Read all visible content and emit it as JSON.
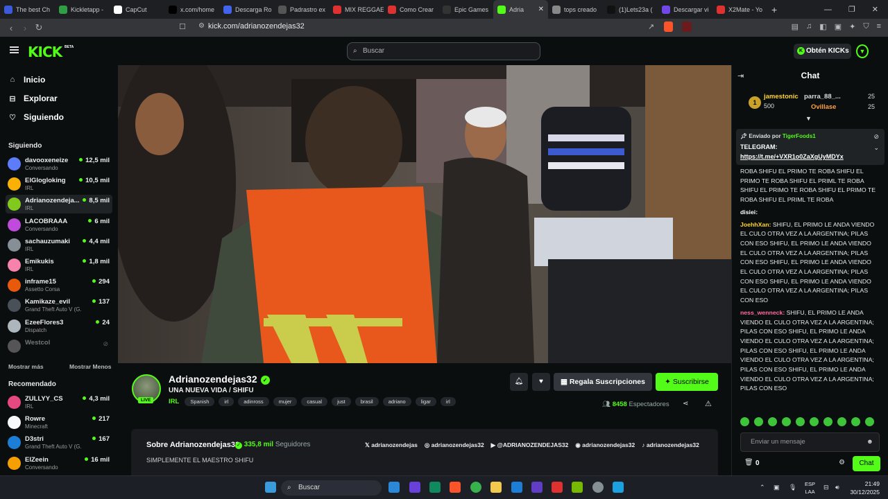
{
  "browser": {
    "tabs": [
      {
        "label": "The best Ch",
        "fav": "globe-icon",
        "color": "#3b5bdb"
      },
      {
        "label": "Kickletapp -",
        "fav": "app-icon",
        "color": "#2f9e44"
      },
      {
        "label": "CapCut",
        "fav": "capcut-icon",
        "color": "#ffffff"
      },
      {
        "label": "x.com/home",
        "fav": "x-icon",
        "color": "#000000"
      },
      {
        "label": "Descarga Ro",
        "fav": "roblox-icon",
        "color": "#4263eb"
      },
      {
        "label": "Padrastro ex",
        "fav": "reddit-icon",
        "color": "#555555"
      },
      {
        "label": "MIX REGGAE",
        "fav": "youtube-icon",
        "color": "#e03131"
      },
      {
        "label": "Como Crear",
        "fav": "youtube-icon",
        "color": "#e03131"
      },
      {
        "label": "Epic Games",
        "fav": "epic-icon",
        "color": "#333333"
      },
      {
        "label": "Adria",
        "fav": "kick-icon",
        "color": "#53fc18",
        "active": true
      },
      {
        "label": "tops creado",
        "fav": "globe-icon",
        "color": "#888888"
      },
      {
        "label": "(1)Lets23a (",
        "fav": "tiktok-icon",
        "color": "#111111"
      },
      {
        "label": "Descargar vi",
        "fav": "twitch-icon",
        "color": "#7048e8"
      },
      {
        "label": "X2Mate - Yo",
        "fav": "x2mate-icon",
        "color": "#e03131"
      }
    ],
    "url": "kick.com/adrianozendejas32"
  },
  "header": {
    "logo": "KICK",
    "beta": "BETA",
    "search_placeholder": "Buscar",
    "get_kicks": "Obtén KICKs"
  },
  "sidebar": {
    "nav": [
      {
        "label": "Inicio",
        "icon": "home-icon"
      },
      {
        "label": "Explorar",
        "icon": "compass-icon"
      },
      {
        "label": "Siguiendo",
        "icon": "heart-icon"
      }
    ],
    "following_title": "Siguiendo",
    "following": [
      {
        "name": "davooxeneize",
        "category": "Conversando",
        "viewers": "12,5 mil",
        "color": "#5c7cfa"
      },
      {
        "name": "ElGlogloking",
        "category": "IRL",
        "viewers": "10,5 mil",
        "color": "#fab005"
      },
      {
        "name": "Adrianozendeja...",
        "category": "IRL",
        "viewers": "8,5 mil",
        "color": "#82c91e",
        "selected": true
      },
      {
        "name": "LACOBRAAA",
        "category": "Conversando",
        "viewers": "6 mil",
        "color": "#be4bdb"
      },
      {
        "name": "sachauzumaki",
        "category": "IRL",
        "viewers": "4,4 mil",
        "color": "#868e96"
      },
      {
        "name": "Emikukis",
        "category": "IRL",
        "viewers": "1,8 mil",
        "color": "#f783ac"
      },
      {
        "name": "inframe15",
        "category": "Assetto Corsa",
        "viewers": "294",
        "color": "#e8590c"
      },
      {
        "name": "Kamikaze_evil",
        "category": "Grand Theft Auto V (G...",
        "viewers": "137",
        "color": "#495057"
      },
      {
        "name": "EzeeFlores3",
        "category": "Dispatch",
        "viewers": "24",
        "color": "#adb5bd"
      },
      {
        "name": "Westcol",
        "category": "",
        "viewers": "",
        "color": "#555555",
        "offline": true
      }
    ],
    "show_more": "Mostrar más",
    "show_less": "Mostrar Menos",
    "recommended_title": "Recomendado",
    "recommended": [
      {
        "name": "ZULLYY_CS",
        "category": "IRL",
        "viewers": "4,3 mil",
        "color": "#e64980"
      },
      {
        "name": "Rowre",
        "category": "Minecraft",
        "viewers": "217",
        "color": "#f8f9fa"
      },
      {
        "name": "D3stri",
        "category": "Grand Theft Auto V (G...",
        "viewers": "167",
        "color": "#1c7ed6"
      },
      {
        "name": "ElZeein",
        "category": "Conversando",
        "viewers": "16 mil",
        "color": "#f59f00"
      }
    ]
  },
  "stream": {
    "channel": "Adrianozendejas32",
    "live": "LIVE",
    "title": "UNA NUEVA VIDA / SHIFU",
    "category": "IRL",
    "tags": [
      "Spanish",
      "irl",
      "adinross",
      "mujer",
      "casual",
      "just",
      "brasil",
      "adriano",
      "ligar",
      "irl"
    ],
    "gift_label": "Regala Suscripciones",
    "subscribe_label": "Suscribirse",
    "viewers_count": "8458",
    "viewers_label": "Espectadores"
  },
  "about": {
    "title": "Sobre Adrianozendejas32",
    "followers": "335,8 mil",
    "followers_label": "Seguidores",
    "description": "SIMPLEMENTE EL MAESTRO SHIFU",
    "socials": [
      {
        "icon": "x-icon",
        "label": "adrianozendejas"
      },
      {
        "icon": "instagram-icon",
        "label": "adrianozendejas32"
      },
      {
        "icon": "youtube-icon",
        "label": "@ADRIANOZENDEJAS32"
      },
      {
        "icon": "discord-icon",
        "label": "adrianozendejas32"
      },
      {
        "icon": "tiktok-icon",
        "label": "adrianozendejas32"
      }
    ]
  },
  "chat": {
    "title": "Chat",
    "leaders": [
      {
        "rank": "1",
        "name": "jamestonic",
        "amount": "500"
      },
      {
        "name": "parra_88_...",
        "amount": "25"
      },
      {
        "name": "Ovillase",
        "amount": "25"
      }
    ],
    "pinned_by_label": "Enviado por",
    "pinned_by": "TigerFoods1",
    "pinned_text": "TELEGRAM:",
    "pinned_link": "https://t.me/+VXR1o0ZaXgUyMDYx",
    "messages": [
      {
        "user": "",
        "text": "ROBA SHIFU EL PRIMO TE ROBA SHIFU EL PRIMO TE ROBA SHIFU EL PRIML TE ROBA SHIFU EL PRIMO TE ROBA SHIFU EL PRIMO TE ROBA SHIFU EL PRIML TE ROBA",
        "ucls": ""
      },
      {
        "user": "disiei:",
        "text": "",
        "ucls": "u3"
      },
      {
        "user": "JoehhXan:",
        "text": " SHIFU, EL PRIMO LE ANDA VIENDO EL CULO OTRA VEZ A LA ARGENTINA; PILAS CON ESO SHIFU, EL PRIMO LE ANDA VIENDO EL CULO OTRA VEZ A LA ARGENTINA; PILAS CON ESO SHIFU, EL PRIMO LE ANDA VIENDO EL CULO OTRA VEZ A LA ARGENTINA; PILAS CON ESO SHIFU, EL PRIMO LE ANDA VIENDO EL CULO OTRA VEZ A LA ARGENTINA; PILAS CON ESO",
        "ucls": "u1"
      },
      {
        "user": "ness_wenneck:",
        "text": " SHIFU, EL PRIMO LE ANDA VIENDO EL CULO OTRA VEZ A LA ARGENTINA; PILAS CON ESO SHIFU, EL PRIMO LE ANDA VIENDO EL CULO OTRA VEZ A LA ARGENTINA; PILAS CON ESO SHIFU, EL PRIMO LE ANDA VIENDO EL CULO OTRA VEZ A LA ARGENTINA; PILAS CON ESO SHIFU, EL PRIMO LE ANDA VIENDO EL CULO OTRA VEZ A LA ARGENTINA; PILAS CON ESO",
        "ucls": "u2"
      }
    ],
    "input_placeholder": "Enviar un mensaje",
    "points": "0",
    "send_label": "Chat"
  },
  "taskbar": {
    "search": "Buscar",
    "lang1": "ESP",
    "lang2": "LAA",
    "time": "21:49",
    "date": "30/12/2025"
  }
}
